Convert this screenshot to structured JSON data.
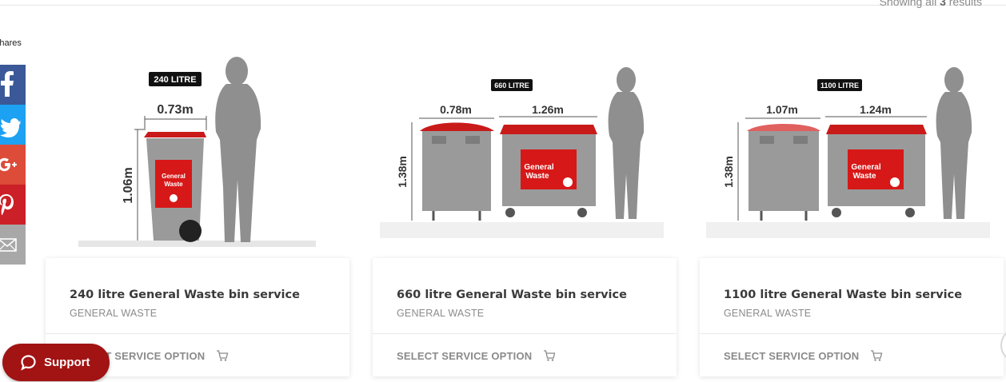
{
  "results_bar": {
    "prefix": "Showing all",
    "count": "3",
    "suffix": "results"
  },
  "share": {
    "label": "Shares",
    "buttons": [
      {
        "network": "facebook",
        "icon": "facebook-icon",
        "color": "#3b5998"
      },
      {
        "network": "twitter",
        "icon": "twitter-icon",
        "color": "#1da1f2"
      },
      {
        "network": "google-plus",
        "icon": "google-plus-icon",
        "color": "#dd4b39"
      },
      {
        "network": "pinterest",
        "icon": "pinterest-icon",
        "color": "#cb2027"
      },
      {
        "network": "email",
        "icon": "envelope-icon",
        "color": "#a8a8a8"
      }
    ]
  },
  "products": [
    {
      "title": "240 litre General Waste bin service",
      "category": "GENERAL WASTE",
      "action": "SELECT SERVICE OPTION",
      "image": {
        "size_label": "240 LITRE",
        "widths": [
          "0.73m"
        ],
        "height": "1.06m",
        "bin_label": [
          "General",
          "Waste"
        ]
      }
    },
    {
      "title": "660 litre General Waste bin service",
      "category": "GENERAL WASTE",
      "action": "SELECT SERVICE OPTION",
      "image": {
        "size_label": "660 LITRE",
        "widths": [
          "0.78m",
          "1.26m"
        ],
        "height": "1.38m",
        "bin_label": [
          "General",
          "Waste"
        ]
      }
    },
    {
      "title": "1100 litre General Waste bin service",
      "category": "GENERAL WASTE",
      "action": "SELECT SERVICE OPTION",
      "image": {
        "size_label": "1100 LITRE",
        "widths": [
          "1.07m",
          "1.24m"
        ],
        "height": "1.38m",
        "bin_label": [
          "General",
          "Waste"
        ]
      }
    }
  ],
  "support": {
    "label": "Support",
    "icon": "chat-bubble-icon",
    "color": "#a21313"
  },
  "colors": {
    "bin_red": "#c91a1a",
    "bin_grey": "#9a9a9a",
    "silhouette": "#8f8f8f"
  }
}
